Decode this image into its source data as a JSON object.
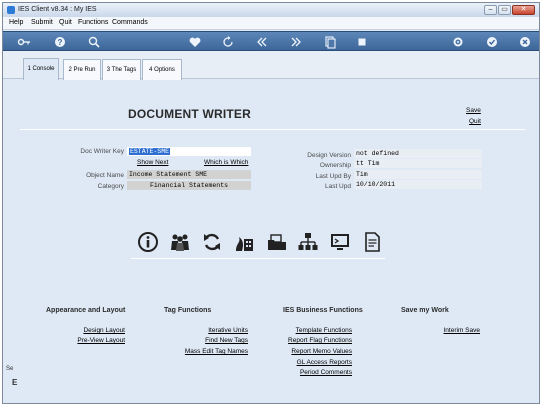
{
  "window": {
    "title": "IES Client v8.34 : My IES",
    "min": "–",
    "max": "▭",
    "close": "✕"
  },
  "menu": [
    "Help",
    "Submit",
    "Quit",
    "Functions",
    "Commands"
  ],
  "tabs": [
    {
      "label": "1 Console",
      "active": true
    },
    {
      "label": "2 Pre Run",
      "active": false
    },
    {
      "label": "3 The Tags",
      "active": false
    },
    {
      "label": "4 Options",
      "active": false
    }
  ],
  "page": {
    "title": "DOCUMENT WRITER",
    "save": "Save",
    "quit": "Quit"
  },
  "form": {
    "doc_writer_key_label": "Doc Writer Key",
    "doc_writer_key_value": "ESTATE-SME",
    "show_next": "Show Next",
    "which_is_which": "Which is Which",
    "object_name_label": "Object Name",
    "object_name_value": "Income Statement SME",
    "category_label": "Category",
    "category_value": "Financial Statements",
    "design_version_label": "Design Version",
    "design_version_value": "not defined",
    "ownership_label": "Ownership",
    "ownership_value": "tt Tim",
    "last_upd_by_label": "Last Upd By",
    "last_upd_by_value": "Tim",
    "last_upd_label": "Last Upd",
    "last_upd_value": "10/10/2011"
  },
  "sections": {
    "appearance": {
      "heading": "Appearance and Layout",
      "links": [
        "Design Layout",
        "Pre-View Layout"
      ]
    },
    "tags": {
      "heading": "Tag Functions",
      "links": [
        "Iterative Units",
        "Find New Tags",
        "Mass Edit Tag Names"
      ]
    },
    "business": {
      "heading": "IES Business Functions",
      "links": [
        "Template Functions",
        "Report Flag Functions",
        "Report Memo Values",
        "GL Access Reports",
        "Period Comments"
      ]
    },
    "save_work": {
      "heading": "Save my Work",
      "links": [
        "Interim Save"
      ]
    }
  },
  "side_fragments": {
    "top": "Se",
    "bottom": "E"
  },
  "toolbar_icons": [
    "key-icon",
    "help-icon",
    "search-icon",
    "heart-icon",
    "refresh-icon",
    "rewind-icon",
    "fast-forward-icon",
    "copy-icon",
    "stop-icon",
    "settings-icon",
    "check-icon",
    "close-icon"
  ],
  "colors": {
    "accent": "#3d6699",
    "background": "#dfe9f5",
    "selection": "#2f6fd1"
  }
}
